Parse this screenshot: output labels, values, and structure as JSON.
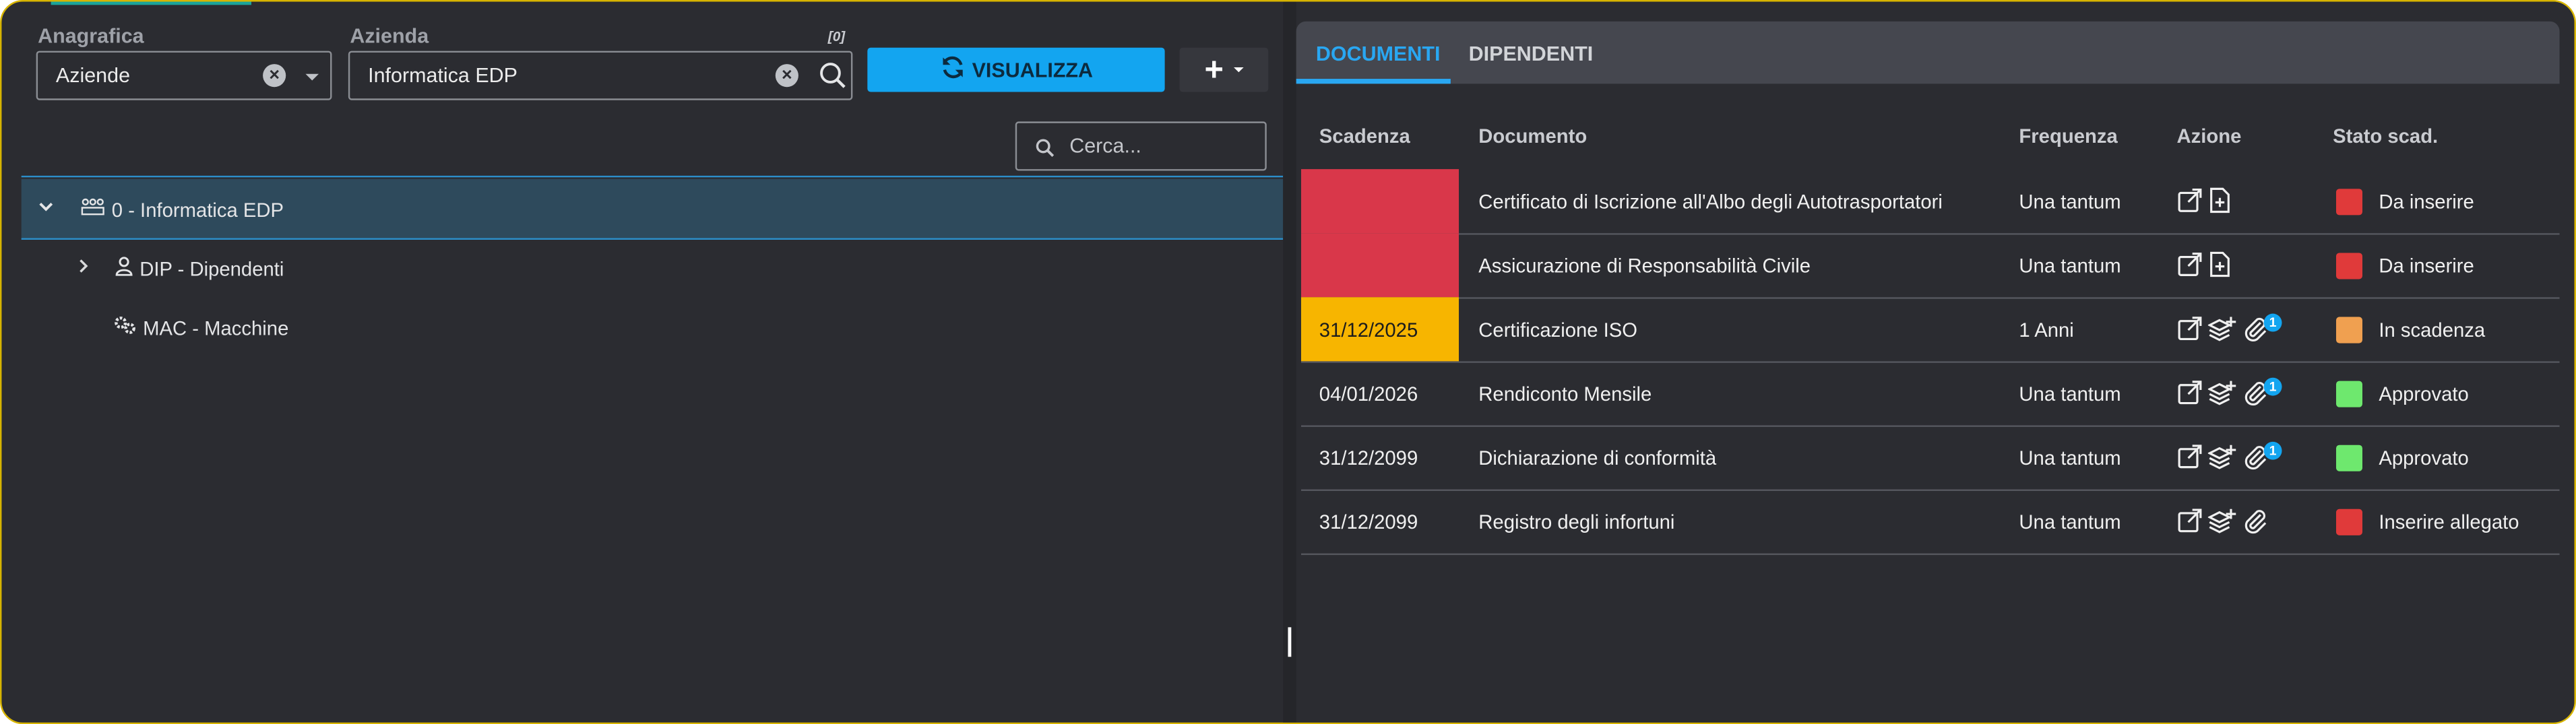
{
  "filters": {
    "anagrafica_label": "Anagrafica",
    "anagrafica_value": "Aziende",
    "azienda_label": "Azienda",
    "azienda_value": "Informatica EDP",
    "count_badge": "[0]"
  },
  "toolbar": {
    "visualizza_label": "VISUALIZZA",
    "add_label": "+"
  },
  "search": {
    "placeholder": "Cerca..."
  },
  "tree": {
    "root": "0 - Informatica EDP",
    "children": [
      {
        "label": "DIP - Dipendenti",
        "icon": "person-icon",
        "expandable": true
      },
      {
        "label": "MAC - Macchine",
        "icon": "gears-icon",
        "expandable": false
      }
    ]
  },
  "tabs": [
    {
      "label": "DOCUMENTI",
      "active": true
    },
    {
      "label": "DIPENDENTI",
      "active": false
    }
  ],
  "table": {
    "headers": [
      "Scadenza",
      "Documento",
      "Frequenza",
      "Azione",
      "Stato scad."
    ],
    "rows": [
      {
        "scadenza": "",
        "scadenza_color": "#d9374a",
        "documento": "Certificato di Iscrizione all'Albo degli Autotrasportatori",
        "frequenza": "Una tantum",
        "actions": [
          "open-external-icon",
          "file-add-icon"
        ],
        "attachments": "",
        "stato": "Da inserire",
        "stato_color": "#e03a3a"
      },
      {
        "scadenza": "",
        "scadenza_color": "#d9374a",
        "documento": "Assicurazione di Responsabilità Civile",
        "frequenza": "Una tantum",
        "actions": [
          "open-external-icon",
          "file-add-icon"
        ],
        "attachments": "",
        "stato": "Da inserire",
        "stato_color": "#e03a3a"
      },
      {
        "scadenza": "31/12/2025",
        "scadenza_color": "#f7b500",
        "documento": "Certificazione ISO",
        "frequenza": "1 Anni",
        "actions": [
          "open-external-icon",
          "layers-add-icon",
          "paperclip-icon"
        ],
        "attachments": "1",
        "stato": "In scadenza",
        "stato_color": "#f0a050"
      },
      {
        "scadenza": "04/01/2026",
        "scadenza_color": "",
        "documento": "Rendiconto Mensile",
        "frequenza": "Una tantum",
        "actions": [
          "open-external-icon",
          "layers-add-icon",
          "paperclip-icon"
        ],
        "attachments": "1",
        "stato": "Approvato",
        "stato_color": "#6ee86e"
      },
      {
        "scadenza": "31/12/2099",
        "scadenza_color": "",
        "documento": "Dichiarazione di conformità",
        "frequenza": "Una tantum",
        "actions": [
          "open-external-icon",
          "layers-add-icon",
          "paperclip-icon"
        ],
        "attachments": "1",
        "stato": "Approvato",
        "stato_color": "#6ee86e"
      },
      {
        "scadenza": "31/12/2099",
        "scadenza_color": "",
        "documento": "Registro degli infortuni",
        "frequenza": "Una tantum",
        "actions": [
          "open-external-icon",
          "layers-add-icon",
          "paperclip-icon"
        ],
        "attachments": "",
        "stato": "Inserire allegato",
        "stato_color": "#e03a3a"
      }
    ]
  },
  "colors": {
    "accent": "#13a5f0",
    "frame_border": "#d7b400",
    "background": "#2b2c31"
  }
}
